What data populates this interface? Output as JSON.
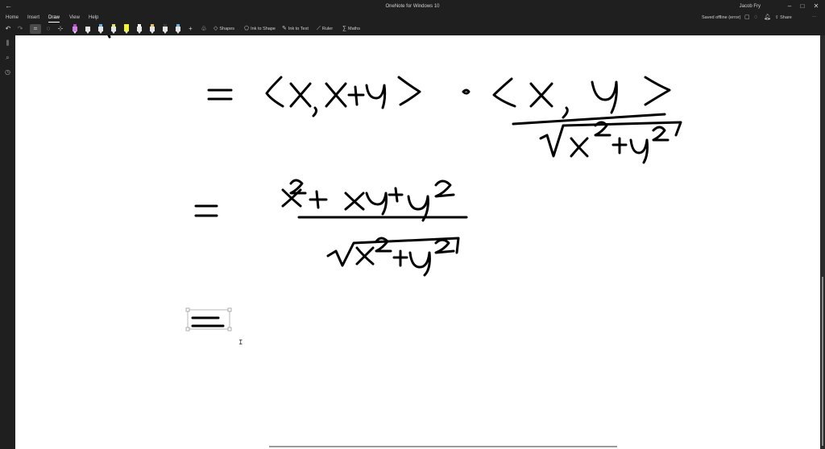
{
  "window": {
    "title": "OneNote for Windows 10",
    "user": "Jacob Fry",
    "back_glyph": "←",
    "minimize_glyph": "–",
    "maximize_glyph": "□",
    "close_glyph": "✕"
  },
  "ribbon": {
    "tabs": [
      {
        "label": "Home"
      },
      {
        "label": "Insert"
      },
      {
        "label": "Draw",
        "active": true
      },
      {
        "label": "View"
      },
      {
        "label": "Help"
      }
    ],
    "status": "Saved offline (error)",
    "share_label": "Share"
  },
  "toolbar": {
    "undo_glyph": "↶",
    "redo_glyph": "↷",
    "add_pen_glyph": "+",
    "shapes_label": "Shapes",
    "ink_to_shape_label": "Ink to Shape",
    "ink_to_text_label": "Ink to Text",
    "ruler_label": "Ruler",
    "maths_label": "Maths",
    "pen_colors": [
      "#b04cc0",
      "#e6e6e6",
      "#59b4e8",
      "#e3e34a",
      "#f2f23a",
      "#ffffff",
      "#e8c04a",
      "#e6e6e6",
      "#59b4e8"
    ]
  },
  "colors": {
    "chrome_bg": "#1f1f1f",
    "canvas_bg": "#ffffff",
    "ink": "#000000"
  },
  "canvas": {
    "cursor_glyph": "I"
  }
}
